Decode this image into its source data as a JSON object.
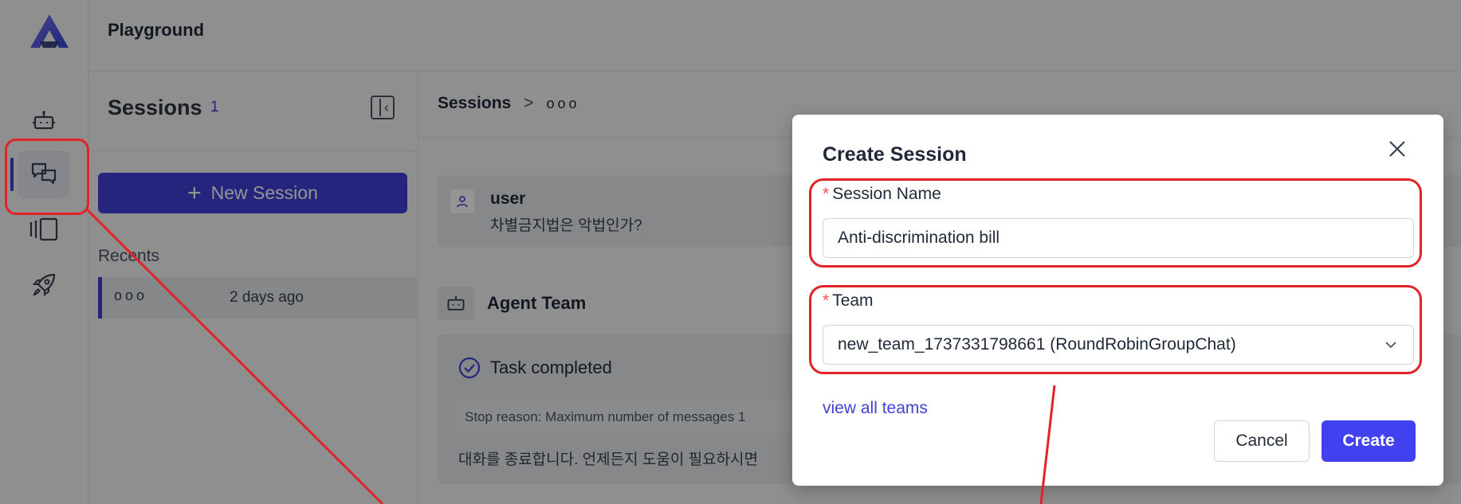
{
  "header": {
    "title": "Playground"
  },
  "sidebar": {
    "title": "Sessions",
    "count": "1",
    "new_session_label": "New Session",
    "recents_label": "Recents",
    "items": [
      {
        "name": "ooo",
        "time": "2 days ago"
      }
    ]
  },
  "main": {
    "breadcrumb_root": "Sessions",
    "breadcrumb_sep": ">",
    "breadcrumb_current": "ooo",
    "user_name": "user",
    "user_message": "차별금지법은 악법인가?",
    "agent_title": "Agent Team",
    "task_status": "Task completed",
    "stop_reason": "Stop reason: Maximum number of messages 1",
    "final_message": "대화를 종료합니다. 언제든지 도움이 필요하시면"
  },
  "modal": {
    "title": "Create Session",
    "session_name_label": "Session Name",
    "session_name_value": "Anti-discrimination bill",
    "team_label": "Team",
    "team_value": "new_team_1737331798661 (RoundRobinGroupChat)",
    "view_all_teams": "view all teams",
    "cancel_label": "Cancel",
    "create_label": "Create"
  },
  "colors": {
    "accent": "#4141d8",
    "annotation": "#e0242a",
    "required": "#ff4d4f"
  },
  "icons": [
    "logo-icon",
    "bot-icon",
    "chat-icon",
    "gallery-icon",
    "rocket-icon",
    "sidebar-collapse-icon",
    "plus-icon",
    "user-icon",
    "check-circle-icon",
    "close-icon",
    "chevron-down-icon"
  ]
}
